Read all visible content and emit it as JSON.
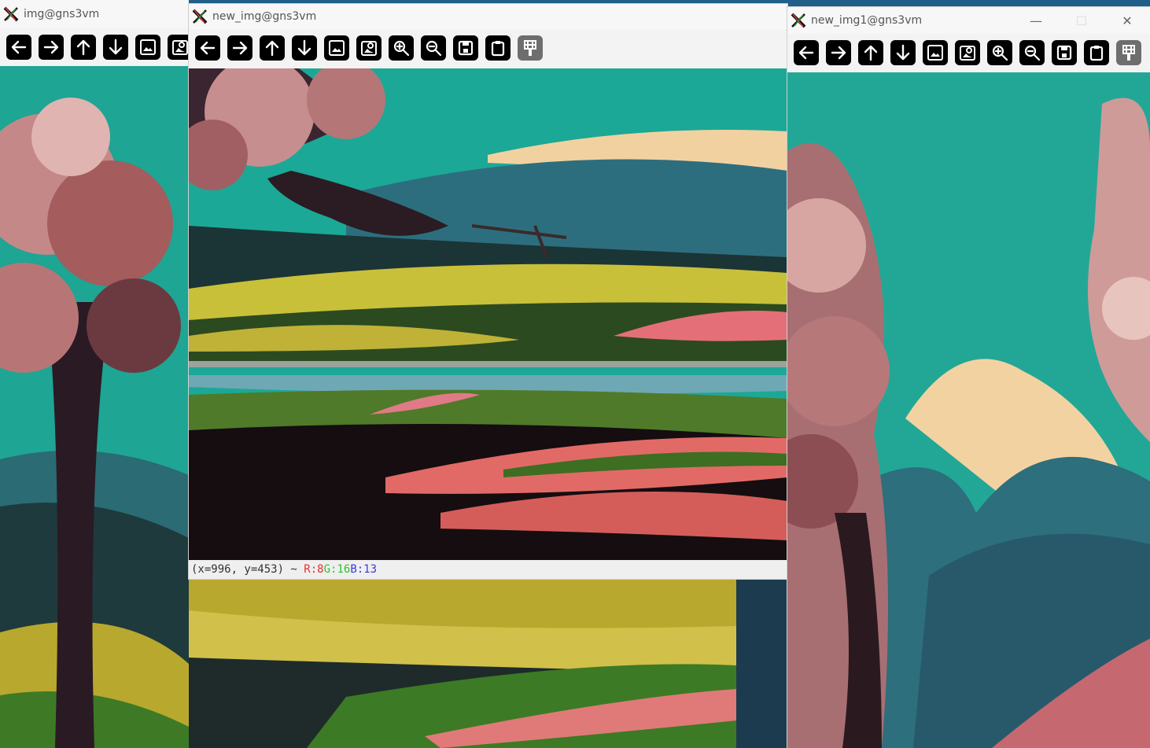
{
  "windows": {
    "img": {
      "title": "img@gns3vm"
    },
    "new_img": {
      "title": "new_img@gns3vm",
      "status": {
        "coords": "(x=996, y=453) ~ ",
        "r": "R:8",
        "g": "G:16",
        "b": "B:13"
      }
    },
    "new_img1": {
      "title": "new_img1@gns3vm"
    }
  },
  "toolbar_icons": [
    "arrow-left-icon",
    "arrow-right-icon",
    "arrow-up-icon",
    "arrow-down-icon",
    "image-icon",
    "image-settings-icon",
    "zoom-in-icon",
    "zoom-out-icon",
    "save-icon",
    "clipboard-icon",
    "properties-icon"
  ],
  "colors": {
    "sky": "#1aa58f",
    "blossom": "#c98a8a",
    "field_yellow": "#c8b53a",
    "field_green": "#3d6e22",
    "dark": "#141014",
    "pink": "#e36c6a",
    "mountain": "#2d6e7e"
  }
}
